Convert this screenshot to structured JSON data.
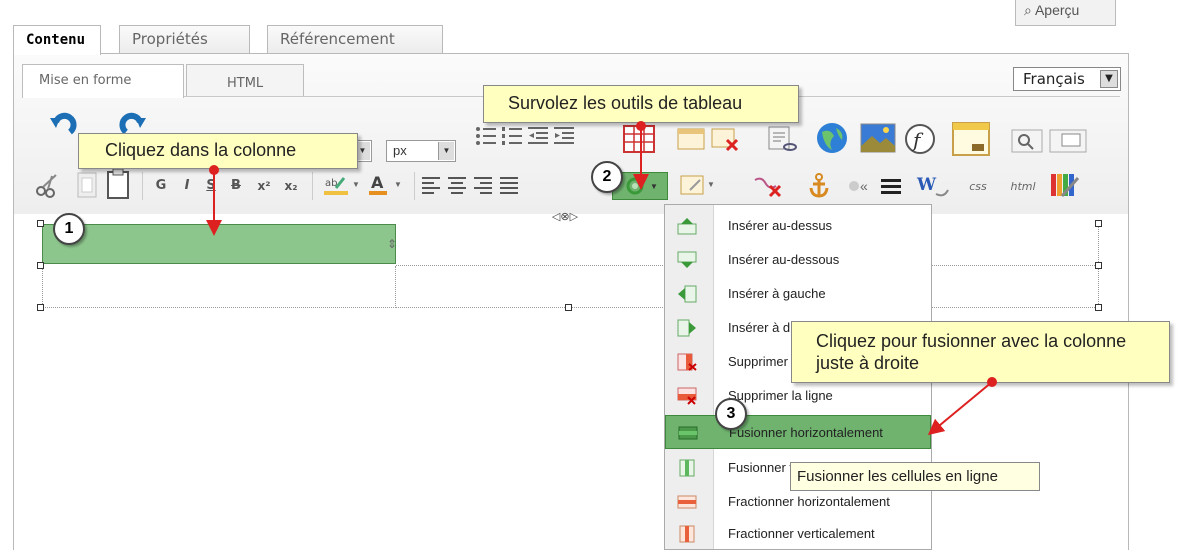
{
  "top_tabs": [
    {
      "label": "Contenu"
    },
    {
      "label": "Propriétés"
    },
    {
      "label": "Référencement"
    }
  ],
  "apercu_label": "Aperçu",
  "sub_tabs": [
    {
      "label": "Mise en forme"
    },
    {
      "label": "HTML"
    }
  ],
  "language": {
    "value": "Français"
  },
  "unit_select": {
    "value": "px"
  },
  "toolbar": {
    "bold_label": "G",
    "italic_label": "I",
    "underline_label": "S",
    "strike_label": "B",
    "superscript_label": "x²",
    "subscript_label": "x₂",
    "css_label": "css",
    "html_label": "html"
  },
  "tooltips": {
    "step1": "Cliquez dans la colonne",
    "step2": "Survolez les outils de tableau",
    "step3_line1": "Cliquez pour fusionner avec la colonne",
    "step3_line2": "juste à droite",
    "hover": "Fusionner les cellules en ligne"
  },
  "step_numbers": [
    "1",
    "2",
    "3"
  ],
  "menu": {
    "items": [
      {
        "label": "Insérer au-dessus",
        "icon": "insert-row-above-icon",
        "color": "#5cb85c"
      },
      {
        "label": "Insérer au-dessous",
        "icon": "insert-row-below-icon",
        "color": "#5cb85c"
      },
      {
        "label": "Insérer à gauche",
        "icon": "insert-col-left-icon",
        "color": "#5cb85c"
      },
      {
        "label": "Insérer à droite",
        "icon": "insert-col-right-icon",
        "color": "#5cb85c"
      },
      {
        "label": "Supprimer la colonne",
        "icon": "delete-col-icon",
        "color": "#d9534f"
      },
      {
        "label": "Supprimer la ligne",
        "icon": "delete-row-icon",
        "color": "#d9534f"
      },
      {
        "label": "Fusionner horizontalement",
        "icon": "merge-horizontal-icon",
        "color": "#5cb85c"
      },
      {
        "label": "Fusionner verticalement",
        "icon": "merge-vertical-icon",
        "color": "#5cb85c"
      },
      {
        "label": "Fractionner horizontalement",
        "icon": "split-horizontal-icon",
        "color": "#e8603c"
      },
      {
        "label": "Fractionner verticalement",
        "icon": "split-vertical-icon",
        "color": "#e8603c"
      }
    ],
    "highlighted_index": 6
  },
  "colors": {
    "selected_cell": "#8dc68d",
    "arrow": "#dd2020",
    "tooltip_bg": "#ffffc0"
  }
}
